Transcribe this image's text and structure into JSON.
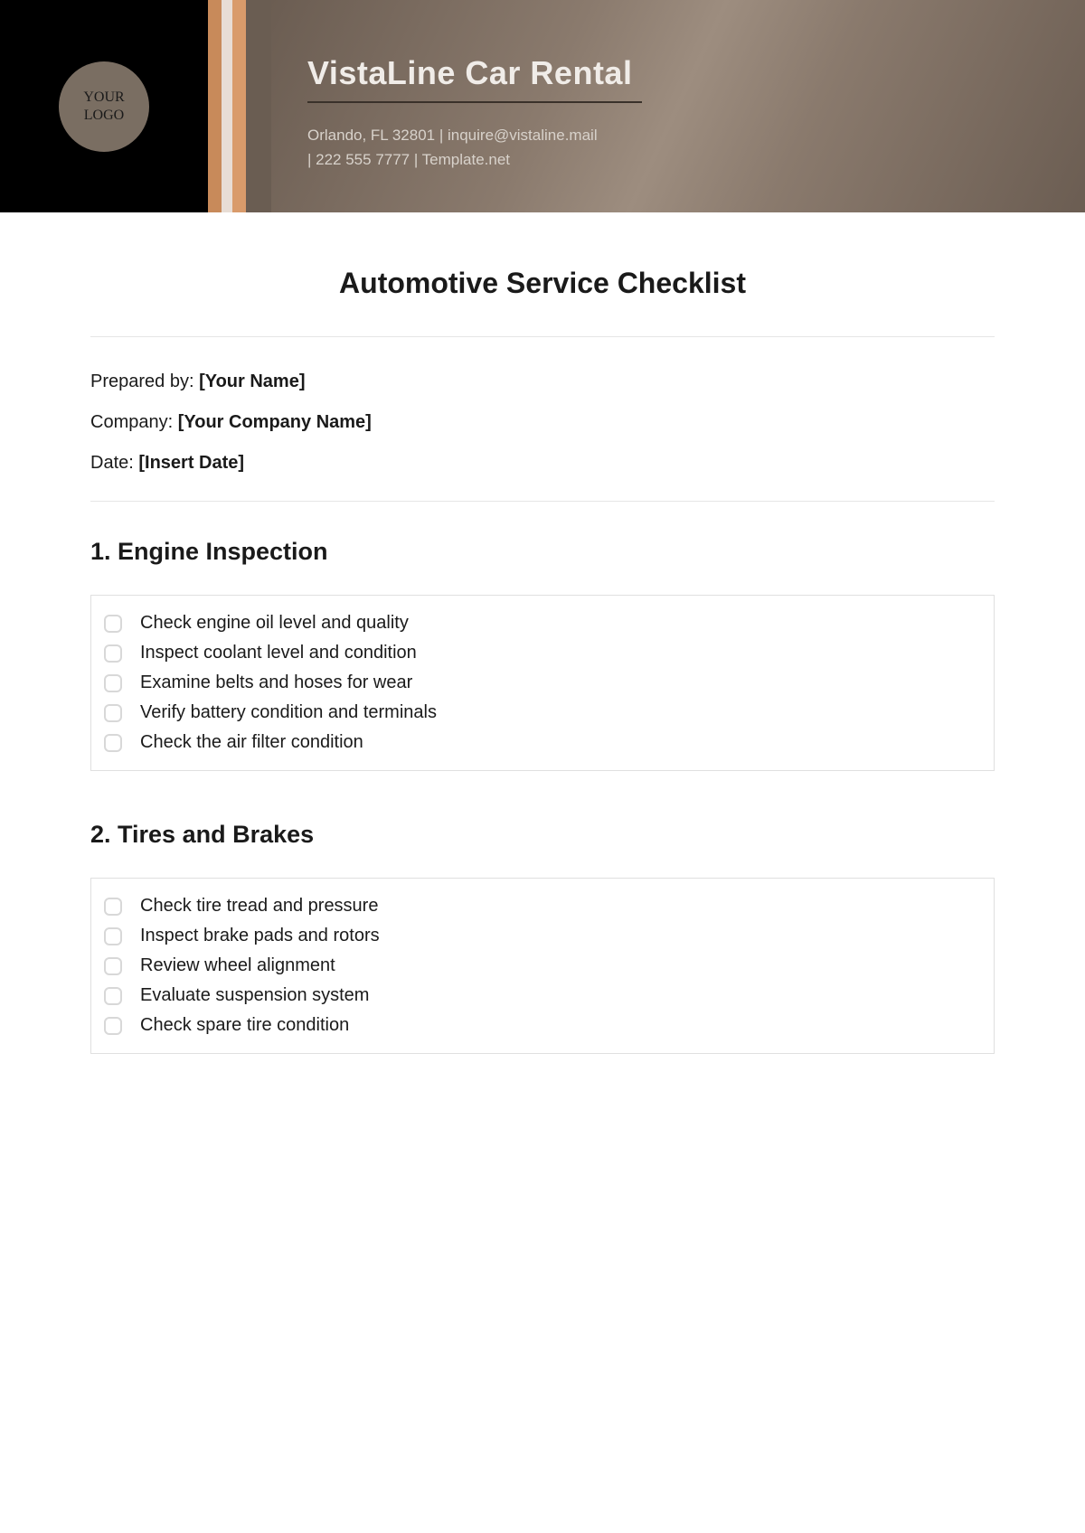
{
  "header": {
    "logo_line1": "YOUR",
    "logo_line2": "LOGO",
    "company_name": "VistaLine Car Rental",
    "contact_line1": "Orlando, FL 32801  |  inquire@vistaline.mail",
    "contact_line2": "|  222 555 7777  |  Template.net"
  },
  "document": {
    "title": "Automotive Service Checklist",
    "meta": {
      "prepared_label": "Prepared by: ",
      "prepared_value": "[Your Name]",
      "company_label": "Company: ",
      "company_value": "[Your Company Name]",
      "date_label": "Date: ",
      "date_value": "[Insert Date]"
    },
    "sections": [
      {
        "title": "1. Engine Inspection",
        "items": [
          "Check engine oil level and quality",
          "Inspect coolant level and condition",
          "Examine belts and hoses for wear",
          "Verify battery condition and terminals",
          "Check the air filter condition"
        ]
      },
      {
        "title": "2. Tires and Brakes",
        "items": [
          "Check tire tread and pressure",
          "Inspect brake pads and rotors",
          "Review wheel alignment",
          "Evaluate suspension system",
          "Check spare tire condition"
        ]
      }
    ]
  }
}
